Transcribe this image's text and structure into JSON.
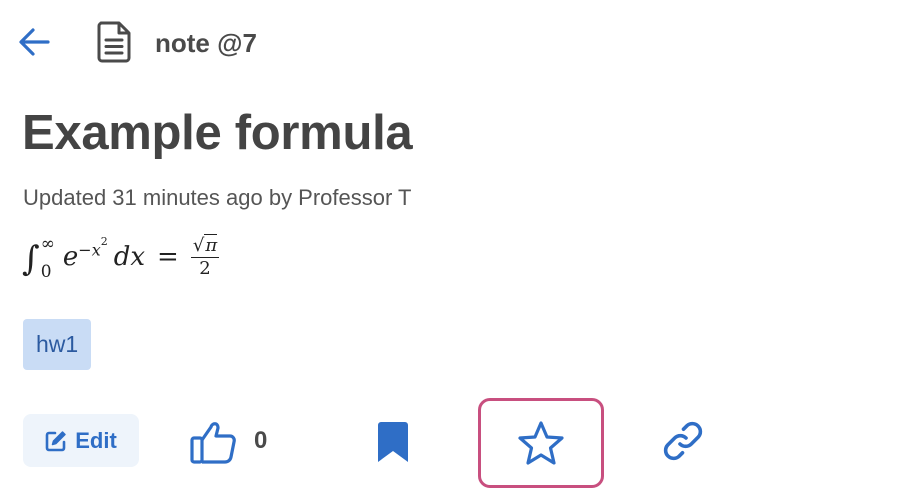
{
  "header": {
    "back_icon": "arrow-left-icon",
    "doc_icon": "document-icon",
    "post_label": "note @7"
  },
  "post": {
    "title": "Example formula",
    "updated": "Updated 31 minutes ago by Professor T",
    "formula": {
      "integral": "∫",
      "upper_limit": "∞",
      "lower_limit": "0",
      "base": "e",
      "exponent_sign": "−",
      "exponent_var": "x",
      "exponent_power": "2",
      "differential": "dx",
      "equals": "=",
      "numerator_root": "√",
      "numerator_value": "π",
      "denominator": "2"
    },
    "tags": [
      {
        "label": "hw1"
      }
    ]
  },
  "actions": {
    "edit_label": "Edit",
    "edit_icon": "pencil-square-icon",
    "like_icon": "thumbs-up-icon",
    "like_count": "0",
    "bookmark_icon": "bookmark-icon",
    "star_icon": "star-icon",
    "link_icon": "link-icon"
  },
  "colors": {
    "accent": "#2f6ec6",
    "tag_bg": "#c9dcf5",
    "tag_text": "#2b5aa0",
    "focus_ring": "#c84f7f",
    "text": "#4a4a4a"
  }
}
